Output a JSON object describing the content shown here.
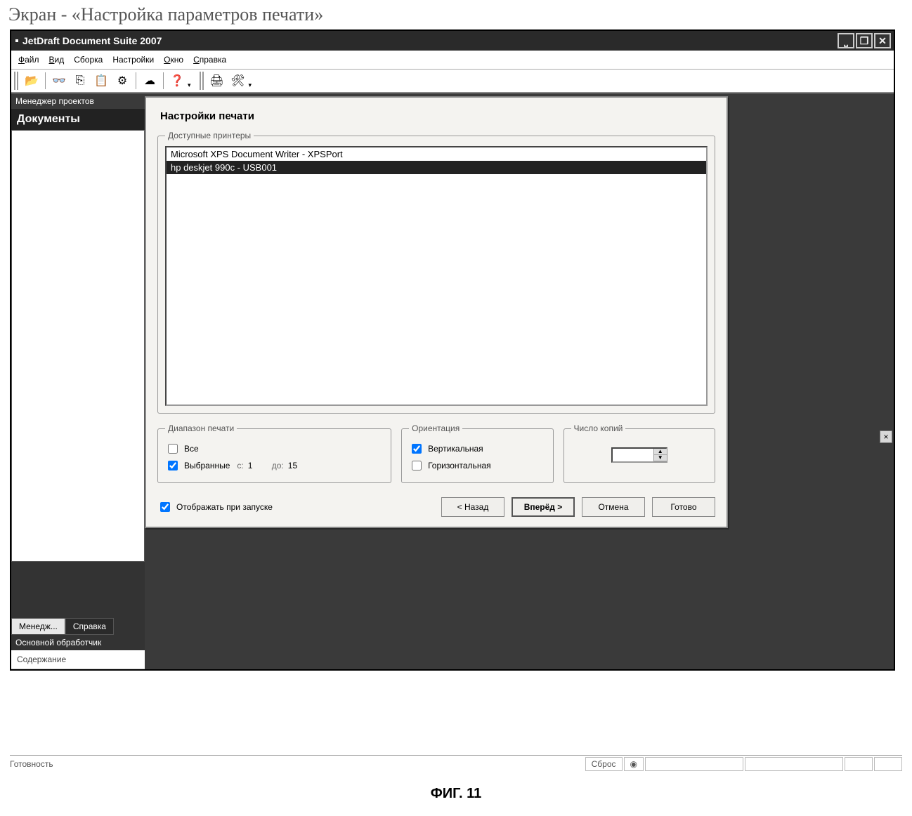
{
  "page_caption": "Экран - «Настройка параметров печати»",
  "titlebar": {
    "title": "JetDraft Document Suite 2007"
  },
  "menu": {
    "file": "Файл",
    "view": "Вид",
    "build": "Сборка",
    "settings": "Настройки",
    "window": "Окно",
    "help": "Справка"
  },
  "sidebar": {
    "pm_title": "Менеджер проектов",
    "docs_heading": "Документы",
    "tab_manager": "Менедж...",
    "tab_help": "Справка",
    "main_processor": "Основной обработчик",
    "content": "Содержание"
  },
  "dialog": {
    "title": "Настройки печати",
    "printers_legend": "Доступные принтеры",
    "printers": [
      {
        "label": "Microsoft XPS Document Writer - XPSPort",
        "selected": false
      },
      {
        "label": "hp deskjet 990c - USB001",
        "selected": true
      }
    ],
    "range": {
      "legend": "Диапазон печати",
      "all": "Все",
      "selected": "Выбранные",
      "from_label": "с:",
      "from_value": "1",
      "to_label": "до:",
      "to_value": "15",
      "all_checked": false,
      "selected_checked": true
    },
    "orientation": {
      "legend": "Ориентация",
      "vertical": "Вертикальная",
      "horizontal": "Горизонтальная",
      "vertical_checked": true,
      "horizontal_checked": false
    },
    "copies": {
      "legend": "Число копий",
      "value": ""
    },
    "show_on_start": {
      "label": "Отображать при запуске",
      "checked": true
    },
    "buttons": {
      "back": "< Назад",
      "next": "Вперёд >",
      "cancel": "Отмена",
      "finish": "Готово"
    }
  },
  "status": {
    "ready": "Готовность",
    "reset": "Сброс"
  },
  "figure_label": "ФИГ. 11"
}
